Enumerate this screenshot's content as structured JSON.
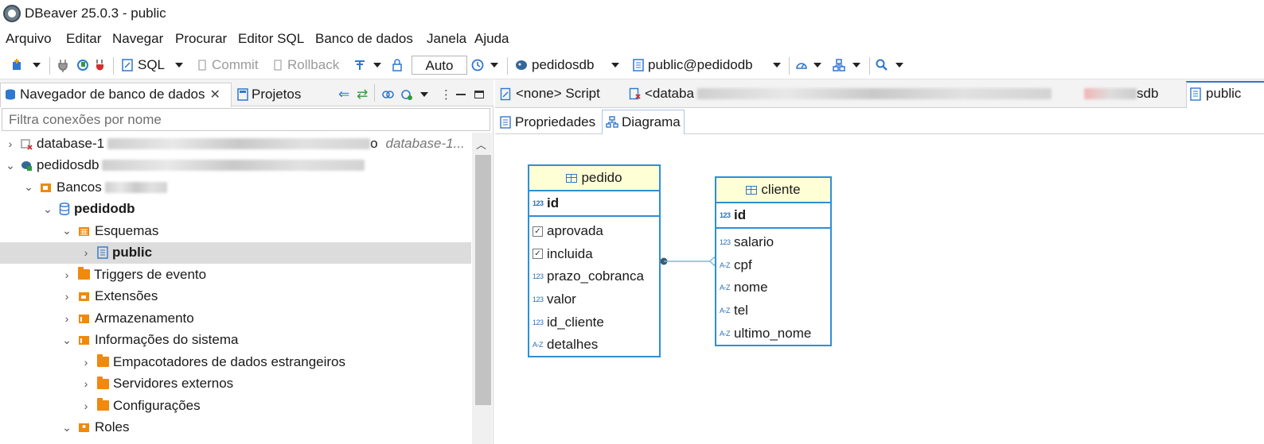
{
  "window": {
    "title": "DBeaver 25.0.3 - public"
  },
  "menu": [
    "Arquivo",
    "Editar",
    "Navegar",
    "Procurar",
    "Editor SQL",
    "Banco de dados",
    "Janela",
    "Ajuda"
  ],
  "toolbar": {
    "sql_label": "SQL",
    "commit_label": "Commit",
    "rollback_label": "Rollback",
    "transaction_mode": "Auto",
    "datasource": "pedidosdb",
    "schema": "public@pedidodb"
  },
  "left_panel": {
    "tab_navigator": "Navegador de banco de dados",
    "tab_projects": "Projetos",
    "filter_placeholder": "Filtra conexões por nome",
    "tree": [
      {
        "label": "database-1",
        "suffix": "o",
        "extra": "database-1..."
      },
      {
        "label": "pedidosdb"
      },
      {
        "label": "Bancos"
      },
      {
        "label": "pedidodb"
      },
      {
        "label": "Esquemas"
      },
      {
        "label": "public"
      },
      {
        "label": "Triggers de evento"
      },
      {
        "label": "Extensões"
      },
      {
        "label": "Armazenamento"
      },
      {
        "label": "Informações do sistema"
      },
      {
        "label": "Empacotadores de dados estrangeiros"
      },
      {
        "label": "Servidores externos"
      },
      {
        "label": "Configurações"
      },
      {
        "label": "Roles"
      }
    ]
  },
  "editor": {
    "tabs": [
      "<none> Script",
      "<databa",
      "sdb",
      "public"
    ],
    "sub_tabs": [
      "Propriedades",
      "Diagrama"
    ]
  },
  "diagram": {
    "entities": [
      {
        "name": "pedido",
        "pk": "id",
        "columns": [
          {
            "name": "aprovada",
            "type": "bool"
          },
          {
            "name": "incluida",
            "type": "bool"
          },
          {
            "name": "prazo_cobranca",
            "type": "num"
          },
          {
            "name": "valor",
            "type": "num"
          },
          {
            "name": "id_cliente",
            "type": "num"
          },
          {
            "name": "detalhes",
            "type": "text"
          }
        ]
      },
      {
        "name": "cliente",
        "pk": "id",
        "columns": [
          {
            "name": "salario",
            "type": "num"
          },
          {
            "name": "cpf",
            "type": "text"
          },
          {
            "name": "nome",
            "type": "text"
          },
          {
            "name": "tel",
            "type": "text"
          },
          {
            "name": "ultimo_nome",
            "type": "text"
          }
        ]
      }
    ],
    "type_glyphs": {
      "num": "123",
      "text": "A-Z"
    }
  }
}
